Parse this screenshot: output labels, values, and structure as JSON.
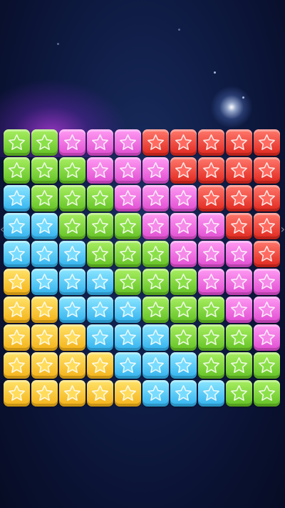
{
  "game": {
    "colors": {
      "G": "#62c123",
      "P": "#e04bd1",
      "R": "#e0261d",
      "B": "#2fb1ee",
      "Y": "#f4b116"
    },
    "tile_icon": "star-icon",
    "grid": [
      [
        "G",
        "G",
        "P",
        "P",
        "P",
        "R",
        "R",
        "R",
        "R",
        "R"
      ],
      [
        "G",
        "G",
        "G",
        "P",
        "P",
        "P",
        "R",
        "R",
        "R",
        "R"
      ],
      [
        "B",
        "G",
        "G",
        "G",
        "P",
        "P",
        "P",
        "R",
        "R",
        "R"
      ],
      [
        "B",
        "B",
        "G",
        "G",
        "G",
        "P",
        "P",
        "P",
        "R",
        "R"
      ],
      [
        "B",
        "B",
        "B",
        "G",
        "G",
        "G",
        "P",
        "P",
        "P",
        "R"
      ],
      [
        "Y",
        "B",
        "B",
        "B",
        "G",
        "G",
        "G",
        "P",
        "P",
        "P"
      ],
      [
        "Y",
        "Y",
        "B",
        "B",
        "B",
        "G",
        "G",
        "G",
        "P",
        "P"
      ],
      [
        "Y",
        "Y",
        "Y",
        "B",
        "B",
        "B",
        "G",
        "G",
        "G",
        "P"
      ],
      [
        "Y",
        "Y",
        "Y",
        "Y",
        "B",
        "B",
        "B",
        "G",
        "G",
        "G"
      ],
      [
        "Y",
        "Y",
        "Y",
        "Y",
        "Y",
        "B",
        "B",
        "B",
        "G",
        "G"
      ]
    ]
  },
  "side_controls": {
    "left_icon": "chevron-left-icon",
    "right_icon": "chevron-right-icon",
    "left_glyph": "‹",
    "right_glyph": "›"
  }
}
